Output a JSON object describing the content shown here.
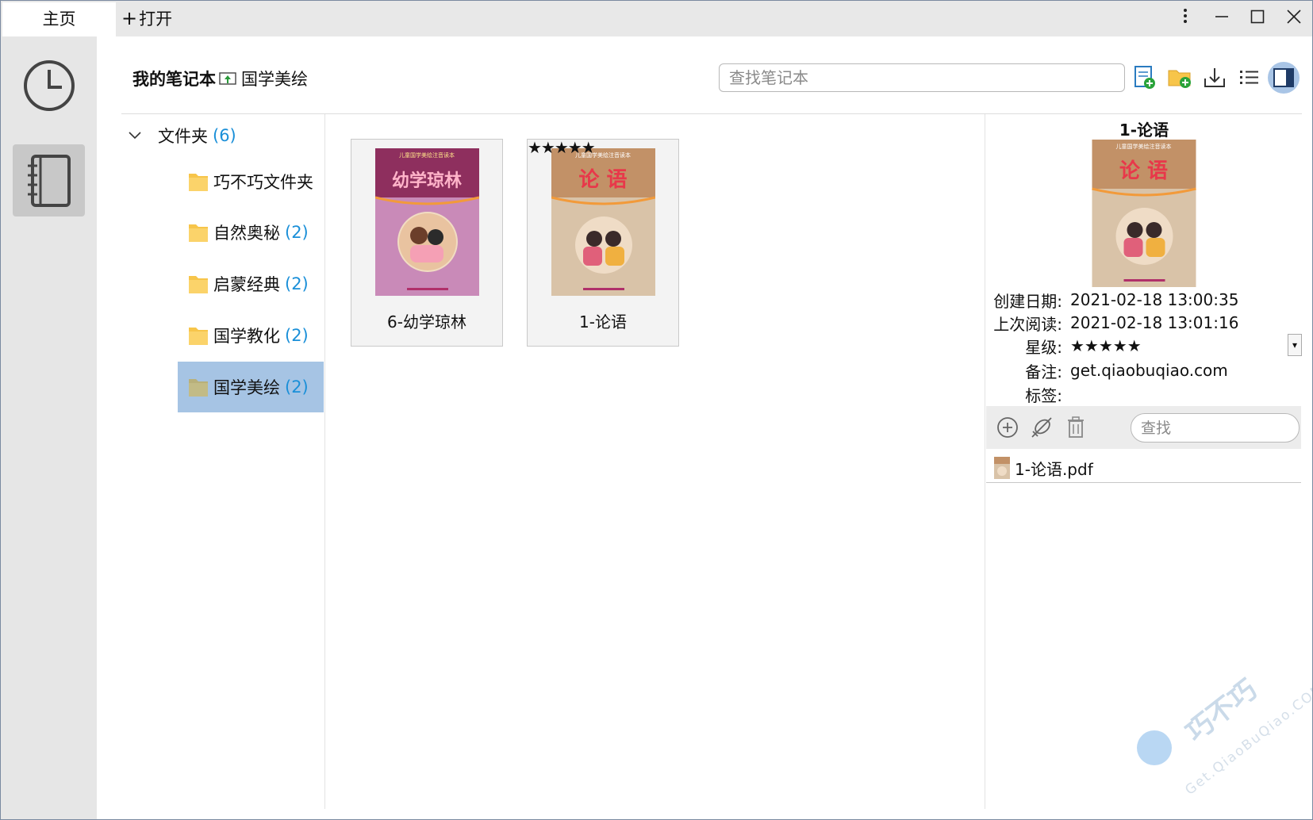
{
  "titlebar": {
    "home_tab": "主页",
    "open_tab": "打开"
  },
  "header": {
    "breadcrumb_root": "我的笔记本",
    "breadcrumb_current": "国学美绘",
    "search_placeholder": "查找笔记本"
  },
  "tree": {
    "root_label": "文件夹",
    "root_count": "(6)",
    "folders": [
      {
        "label": "巧不巧文件夹",
        "count": ""
      },
      {
        "label": "自然奥秘",
        "count": "(2)"
      },
      {
        "label": "启蒙经典",
        "count": "(2)"
      },
      {
        "label": "国学教化",
        "count": "(2)"
      },
      {
        "label": "国学美绘",
        "count": "(2)"
      }
    ]
  },
  "notebooks": [
    {
      "title": "6-幼学琼林",
      "cover_text": "幼学琼林",
      "cover_banner": "儿童国学美绘注音读本",
      "stars": ""
    },
    {
      "title": "1-论语",
      "cover_text": "论 语",
      "cover_banner": "儿童国学美绘注音读本",
      "stars": "★★★★★"
    }
  ],
  "details": {
    "title": "1-论语",
    "cover_text": "论 语",
    "cover_banner": "儿童国学美绘注音读本",
    "created_label": "创建日期:",
    "created_value": "2021-02-18 13:00:35",
    "last_read_label": "上次阅读:",
    "last_read_value": "2021-02-18 13:01:16",
    "rating_label": "星级:",
    "rating_value": "★★★★★",
    "note_label": "备注:",
    "note_value": "get.qiaobuqiao.com",
    "tags_label": "标签:",
    "tags_value": "",
    "attachment_search_placeholder": "查找",
    "attachments": [
      "1-论语.pdf"
    ]
  },
  "watermark": {
    "brand": "巧不巧",
    "site": "Get.QiaoBuQiao.COM"
  },
  "colors": {
    "accent_blue": "#1a8fd8",
    "selected_folder": "#a6c4e4",
    "folder_yellow": "#f7c54a",
    "rail_bg": "#e6e6e6"
  }
}
